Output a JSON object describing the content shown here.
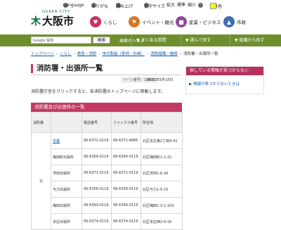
{
  "utility": {
    "language": "Language",
    "furigana": "ふりがな",
    "yomiage": "読み上げ",
    "moji_size": "文字サイズ",
    "kakudai": "拡大",
    "hyojun": "標準",
    "shukusho": "縮小",
    "iro": "色",
    "haikei": "背景色"
  },
  "logo": {
    "sub": "OSAKA CITY",
    "mark": "⽊",
    "text": "大阪市"
  },
  "categories": [
    {
      "label": "くらし",
      "color": "#c8345e",
      "icon": "heart-icon"
    },
    {
      "label": "イベント・観光",
      "color": "#d27a23",
      "icon": "flag-icon"
    },
    {
      "label": "産業・ビジネス",
      "color": "#8c4a9c",
      "icon": "briefcase-icon"
    },
    {
      "label": "市政",
      "color": "#3f6db3",
      "icon": "building-icon"
    }
  ],
  "search": {
    "placeholder": "Google 提供",
    "button": "検索",
    "help": "検索のヘルプ"
  },
  "nav": [
    {
      "label": "▼ よくある質問",
      "color": "#7fa23b"
    },
    {
      "label": "▼ 選んで探す",
      "color": "#7fa23b"
    },
    {
      "label": "▼ 組織から探す",
      "color": "#7fa23b"
    }
  ],
  "breadcrumb": [
    "トップページ",
    "くらし",
    "救急・消防",
    "市の取組（条例・計画）",
    "消防組織・施設",
    "消防署・出張所一覧"
  ],
  "page": {
    "title": "消防署・出張所一覧",
    "page_id": "ページ番号：18695",
    "updated": "2022年5月18日",
    "intro": "消防署庁舎をクリックすると、各消防署のトップページに移動します。"
  },
  "sidebar": {
    "header": "探している情報が見つからない",
    "link": "▶ 情報が見つからないときは"
  },
  "table": {
    "heading": "消防署及び出張所の一覧",
    "headers": [
      "消防署",
      "",
      "電話番号",
      "ファックス番号",
      "所在地"
    ],
    "ward": "北",
    "rows": [
      {
        "name": "本署",
        "tel": "06-6372-0119",
        "fax": "06-6372-4885",
        "addr": "北区本庄東2丁目9-41"
      },
      {
        "name": "梅田町出張所",
        "tel": "06-6364-0119",
        "fax": "06-6364-0119",
        "addr": "北区梅田町1-1-22"
      },
      {
        "name": "浮田出張所",
        "tel": "06-6371-0119",
        "fax": "06-6371-0119",
        "addr": "北区浮田1-6-26"
      },
      {
        "name": "与力出張所",
        "tel": "06-6358-0119",
        "fax": "06-6358-0119",
        "addr": "北区与力1-5-15"
      },
      {
        "name": "梅田出張所",
        "tel": "06-6349-0119",
        "fax": "06-6349-0119",
        "addr": "北区梅田1-2-1-100"
      },
      {
        "name": "本庄出張所",
        "tel": "06-6374-0119",
        "fax": "06-6374-0119",
        "addr": "北区本庄西2-6-16"
      }
    ]
  }
}
